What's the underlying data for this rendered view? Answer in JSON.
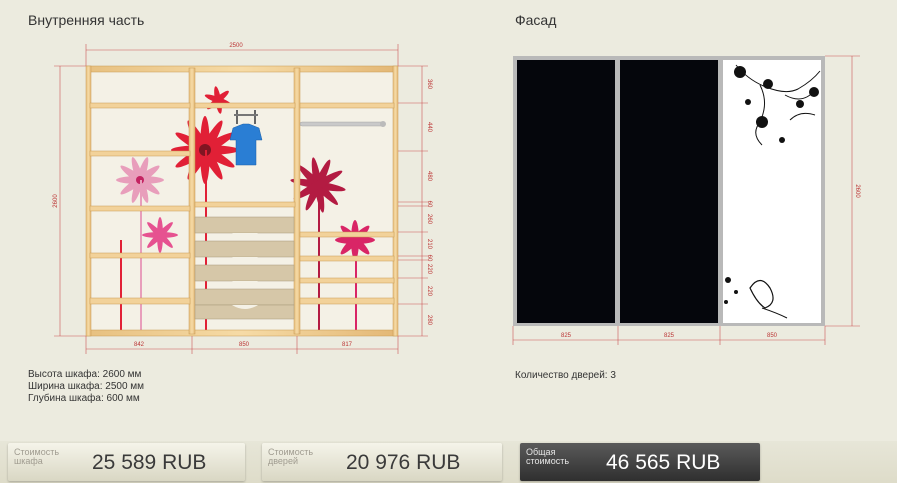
{
  "interior": {
    "title": "Внутренняя часть",
    "dims": {
      "total_width": "2500",
      "height": "2600",
      "col_widths": [
        "842",
        "850",
        "817"
      ],
      "right_shelves": [
        "360",
        "440",
        "480",
        "60",
        "260",
        "210",
        "60",
        "220",
        "220",
        "280"
      ]
    }
  },
  "facade": {
    "title": "Фасад",
    "dims": {
      "height": "2600",
      "door_widths": [
        "825",
        "825",
        "850"
      ]
    }
  },
  "specs": {
    "height": "Высота шкафа: 2600 мм",
    "width": "Ширина шкафа: 2500 мм",
    "depth": "Глубина шкафа: 600 мм"
  },
  "doors_count": "Количество дверей: 3",
  "prices": {
    "cabinet": {
      "label_line1": "Стоимость",
      "label_line2": "шкафа",
      "value": "25 589  RUB"
    },
    "doors": {
      "label_line1": "Стоимость",
      "label_line2": "дверей",
      "value": "20 976  RUB"
    },
    "total": {
      "label_line1": "Общая",
      "label_line2": "стоимость",
      "value": "46 565  RUB"
    }
  },
  "colors": {
    "background": "#ecebdf",
    "wood": "#f2d29a",
    "wood_edge": "#c89a52",
    "dimension": "#c55555",
    "door_black": "#05060c",
    "door_frame": "#b9b9b9"
  }
}
